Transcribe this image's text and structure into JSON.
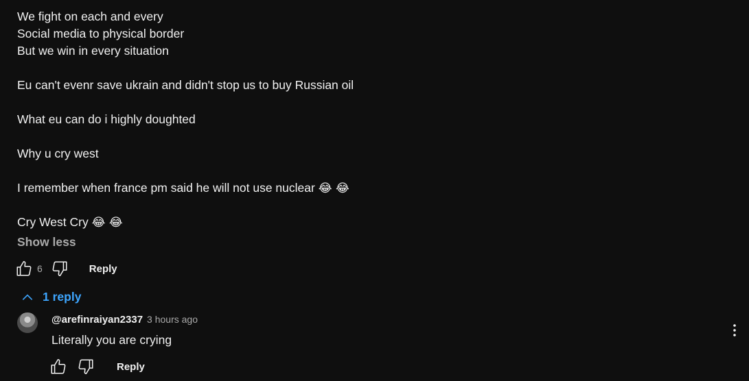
{
  "comment": {
    "lines": [
      "We fight on each and every",
      "Social media to physical border",
      "But we win in every situation",
      "",
      "Eu can't evenr save ukrain and didn't stop us to buy Russian oil",
      "",
      "What eu can do i highly doughted",
      "",
      "Why u cry west",
      "",
      "I remember when france pm said he will not use nuclear",
      "",
      "Cry West Cry"
    ],
    "emoji_nuclear": "😂 😂",
    "emoji_cry": "😂 😂",
    "show_less_label": "Show less",
    "like_count": "6",
    "reply_label": "Reply"
  },
  "replies_toggle": {
    "label": "1 reply"
  },
  "reply": {
    "author": "@arefinraiyan2337",
    "time": "3 hours ago",
    "text": "Literally you are crying",
    "reply_label": "Reply"
  },
  "colors": {
    "background": "#0f0f0f",
    "text": "#f1f1f1",
    "secondary": "#aaaaaa",
    "link": "#3ea6ff"
  },
  "icons": {
    "like": "thumbs-up-icon",
    "dislike": "thumbs-down-icon",
    "collapse": "chevron-up-icon",
    "more": "more-vertical-icon"
  }
}
